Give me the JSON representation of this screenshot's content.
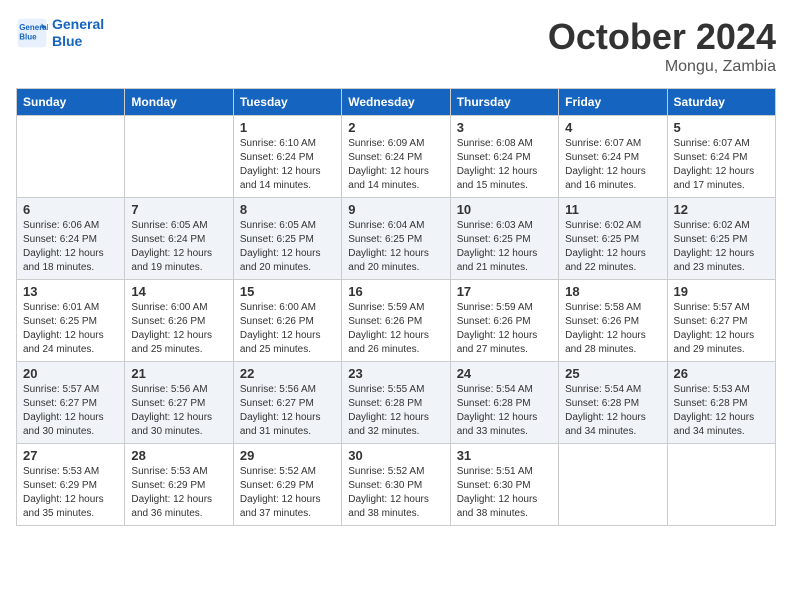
{
  "header": {
    "logo_line1": "General",
    "logo_line2": "Blue",
    "month": "October 2024",
    "location": "Mongu, Zambia"
  },
  "weekdays": [
    "Sunday",
    "Monday",
    "Tuesday",
    "Wednesday",
    "Thursday",
    "Friday",
    "Saturday"
  ],
  "weeks": [
    [
      {
        "day": "",
        "info": ""
      },
      {
        "day": "",
        "info": ""
      },
      {
        "day": "1",
        "info": "Sunrise: 6:10 AM\nSunset: 6:24 PM\nDaylight: 12 hours\nand 14 minutes."
      },
      {
        "day": "2",
        "info": "Sunrise: 6:09 AM\nSunset: 6:24 PM\nDaylight: 12 hours\nand 14 minutes."
      },
      {
        "day": "3",
        "info": "Sunrise: 6:08 AM\nSunset: 6:24 PM\nDaylight: 12 hours\nand 15 minutes."
      },
      {
        "day": "4",
        "info": "Sunrise: 6:07 AM\nSunset: 6:24 PM\nDaylight: 12 hours\nand 16 minutes."
      },
      {
        "day": "5",
        "info": "Sunrise: 6:07 AM\nSunset: 6:24 PM\nDaylight: 12 hours\nand 17 minutes."
      }
    ],
    [
      {
        "day": "6",
        "info": "Sunrise: 6:06 AM\nSunset: 6:24 PM\nDaylight: 12 hours\nand 18 minutes."
      },
      {
        "day": "7",
        "info": "Sunrise: 6:05 AM\nSunset: 6:24 PM\nDaylight: 12 hours\nand 19 minutes."
      },
      {
        "day": "8",
        "info": "Sunrise: 6:05 AM\nSunset: 6:25 PM\nDaylight: 12 hours\nand 20 minutes."
      },
      {
        "day": "9",
        "info": "Sunrise: 6:04 AM\nSunset: 6:25 PM\nDaylight: 12 hours\nand 20 minutes."
      },
      {
        "day": "10",
        "info": "Sunrise: 6:03 AM\nSunset: 6:25 PM\nDaylight: 12 hours\nand 21 minutes."
      },
      {
        "day": "11",
        "info": "Sunrise: 6:02 AM\nSunset: 6:25 PM\nDaylight: 12 hours\nand 22 minutes."
      },
      {
        "day": "12",
        "info": "Sunrise: 6:02 AM\nSunset: 6:25 PM\nDaylight: 12 hours\nand 23 minutes."
      }
    ],
    [
      {
        "day": "13",
        "info": "Sunrise: 6:01 AM\nSunset: 6:25 PM\nDaylight: 12 hours\nand 24 minutes."
      },
      {
        "day": "14",
        "info": "Sunrise: 6:00 AM\nSunset: 6:26 PM\nDaylight: 12 hours\nand 25 minutes."
      },
      {
        "day": "15",
        "info": "Sunrise: 6:00 AM\nSunset: 6:26 PM\nDaylight: 12 hours\nand 25 minutes."
      },
      {
        "day": "16",
        "info": "Sunrise: 5:59 AM\nSunset: 6:26 PM\nDaylight: 12 hours\nand 26 minutes."
      },
      {
        "day": "17",
        "info": "Sunrise: 5:59 AM\nSunset: 6:26 PM\nDaylight: 12 hours\nand 27 minutes."
      },
      {
        "day": "18",
        "info": "Sunrise: 5:58 AM\nSunset: 6:26 PM\nDaylight: 12 hours\nand 28 minutes."
      },
      {
        "day": "19",
        "info": "Sunrise: 5:57 AM\nSunset: 6:27 PM\nDaylight: 12 hours\nand 29 minutes."
      }
    ],
    [
      {
        "day": "20",
        "info": "Sunrise: 5:57 AM\nSunset: 6:27 PM\nDaylight: 12 hours\nand 30 minutes."
      },
      {
        "day": "21",
        "info": "Sunrise: 5:56 AM\nSunset: 6:27 PM\nDaylight: 12 hours\nand 30 minutes."
      },
      {
        "day": "22",
        "info": "Sunrise: 5:56 AM\nSunset: 6:27 PM\nDaylight: 12 hours\nand 31 minutes."
      },
      {
        "day": "23",
        "info": "Sunrise: 5:55 AM\nSunset: 6:28 PM\nDaylight: 12 hours\nand 32 minutes."
      },
      {
        "day": "24",
        "info": "Sunrise: 5:54 AM\nSunset: 6:28 PM\nDaylight: 12 hours\nand 33 minutes."
      },
      {
        "day": "25",
        "info": "Sunrise: 5:54 AM\nSunset: 6:28 PM\nDaylight: 12 hours\nand 34 minutes."
      },
      {
        "day": "26",
        "info": "Sunrise: 5:53 AM\nSunset: 6:28 PM\nDaylight: 12 hours\nand 34 minutes."
      }
    ],
    [
      {
        "day": "27",
        "info": "Sunrise: 5:53 AM\nSunset: 6:29 PM\nDaylight: 12 hours\nand 35 minutes."
      },
      {
        "day": "28",
        "info": "Sunrise: 5:53 AM\nSunset: 6:29 PM\nDaylight: 12 hours\nand 36 minutes."
      },
      {
        "day": "29",
        "info": "Sunrise: 5:52 AM\nSunset: 6:29 PM\nDaylight: 12 hours\nand 37 minutes."
      },
      {
        "day": "30",
        "info": "Sunrise: 5:52 AM\nSunset: 6:30 PM\nDaylight: 12 hours\nand 38 minutes."
      },
      {
        "day": "31",
        "info": "Sunrise: 5:51 AM\nSunset: 6:30 PM\nDaylight: 12 hours\nand 38 minutes."
      },
      {
        "day": "",
        "info": ""
      },
      {
        "day": "",
        "info": ""
      }
    ]
  ]
}
